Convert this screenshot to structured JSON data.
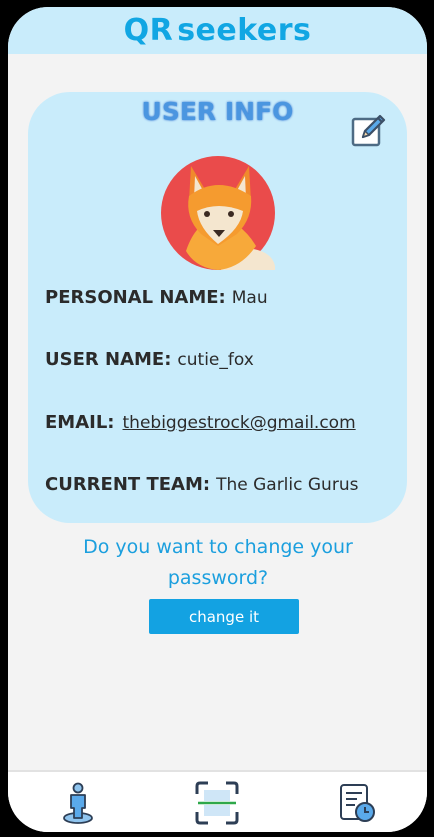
{
  "app": {
    "title_prefix": "QR",
    "title_suffix": "seekers"
  },
  "card": {
    "title": "USER INFO",
    "fields": [
      {
        "label": "PERSONAL NAME:",
        "value": "Mau"
      },
      {
        "label": "USER NAME:",
        "value": "cutie_fox"
      },
      {
        "label": "EMAIL:",
        "value": "thebiggestrock@gmail.com"
      },
      {
        "label": "CURRENT TEAM:",
        "value": "The Garlic Gurus"
      }
    ]
  },
  "password": {
    "question": "Do you want to change your password?",
    "button_label": "change it"
  },
  "icons": {
    "edit": "edit-pencil-icon",
    "avatar": "fox-avatar",
    "nav": [
      "user-profile-icon",
      "qr-scanner-icon",
      "history-report-icon"
    ]
  },
  "colors": {
    "accent": "#13a2e2",
    "header_bg": "#c9ecfb",
    "card_bg": "#c9ecfb"
  }
}
